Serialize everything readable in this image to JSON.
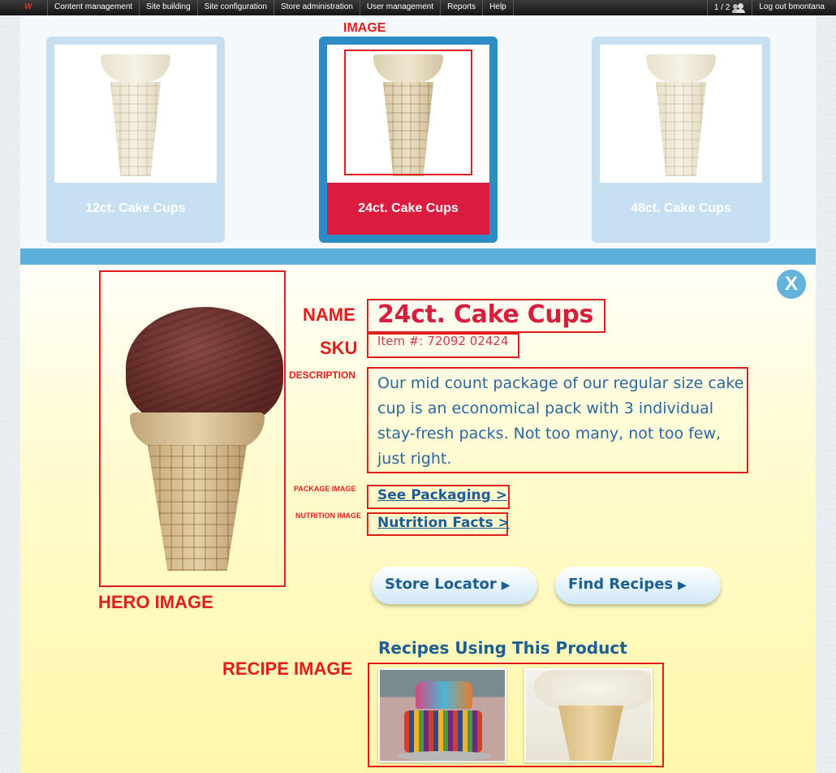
{
  "admin_bar": {
    "logo": "W",
    "menu": [
      "Content management",
      "Site building",
      "Site configuration",
      "Store administration",
      "User management",
      "Reports",
      "Help"
    ],
    "counter": "1 / 2",
    "logout": "Log out bmontana"
  },
  "products": [
    {
      "name": "12ct. Cake Cups",
      "selected": false
    },
    {
      "name": "24ct. Cake Cups",
      "selected": true
    },
    {
      "name": "48ct. Cake Cups",
      "selected": false
    }
  ],
  "annotations": {
    "image": "IMAGE",
    "name": "NAME",
    "sku": "SKU",
    "description": "DESCRIPTION",
    "package_image": "PACKAGE IMAGE",
    "nutrition_image": "NUTRITION IMAGE",
    "hero_image": "HERO IMAGE",
    "recipe_image": "RECIPE IMAGE"
  },
  "detail": {
    "close": "X",
    "name": "24ct. Cake Cups",
    "sku": "Item #: 72092 02424",
    "description": "Our mid count package of our regular size cake cup is an economical pack with 3 individual stay-fresh packs. Not too many, not too few, just right.",
    "see_packaging": "See Packaging >",
    "nutrition_facts": "Nutrition Facts >",
    "store_locator": "Store Locator",
    "find_recipes": "Find Recipes",
    "recipes_heading": "Recipes Using This Product"
  },
  "colors": {
    "accent_red": "#dc1c3f",
    "annotation_red": "#e21d1d",
    "accent_blue": "#2d8bc6",
    "link_blue": "#1d5c99"
  }
}
